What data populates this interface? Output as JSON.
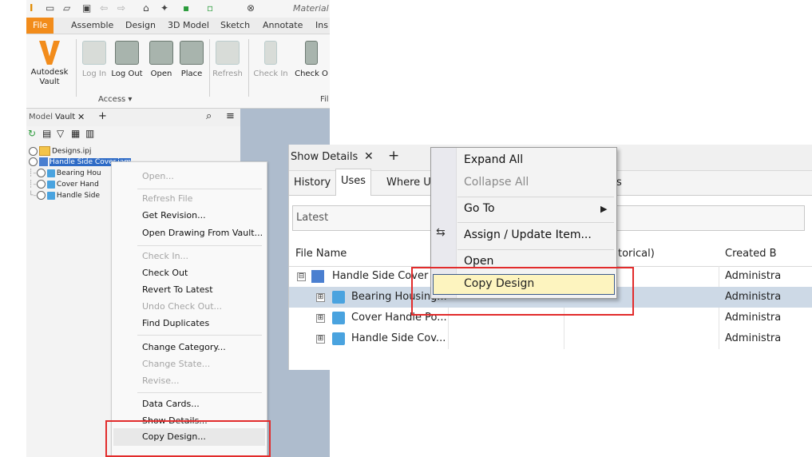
{
  "inventor": {
    "title": "Material",
    "tabs": [
      "File",
      "Assemble",
      "Design",
      "3D Model",
      "Sketch",
      "Annotate",
      "Ins"
    ],
    "ribbon": {
      "autodesk_vault": "Autodesk Vault",
      "buttons": [
        "Log In",
        "Log Out",
        "Open",
        "Place",
        "Refresh",
        "Check In",
        "Check O"
      ],
      "group_access": "Access ▾",
      "group_fi": "Fil"
    },
    "browser_tabs": {
      "model": "Model",
      "vault": "Vault",
      "close": "✕",
      "add": "+"
    },
    "tree": {
      "project": "Designs.ipj",
      "root": "Handle Side Cover.iam",
      "children": [
        "Bearing Hou",
        "Cover Hand",
        "Handle Side"
      ]
    },
    "context_menu": {
      "items": [
        {
          "label": "Open...",
          "disabled": true
        },
        {
          "label": "Refresh File",
          "disabled": true
        },
        {
          "label": "Get Revision...",
          "disabled": false
        },
        {
          "label": "Open Drawing From Vault...",
          "disabled": false
        },
        {
          "label": "Check In...",
          "disabled": true
        },
        {
          "label": "Check Out",
          "disabled": false
        },
        {
          "label": "Revert To Latest",
          "disabled": false
        },
        {
          "label": "Undo Check Out...",
          "disabled": true
        },
        {
          "label": "Find Duplicates",
          "disabled": false
        },
        {
          "label": "Change Category...",
          "disabled": false
        },
        {
          "label": "Change State...",
          "disabled": true
        },
        {
          "label": "Revise...",
          "disabled": true
        },
        {
          "label": "Data Cards...",
          "disabled": false
        },
        {
          "label": "Show Details...",
          "disabled": false
        },
        {
          "label": "Copy Design...",
          "disabled": false
        }
      ]
    }
  },
  "show_details": {
    "tab_title": "Show Details",
    "close": "✕",
    "add": "+",
    "subtabs": [
      "History",
      "Uses",
      "Where U",
      "s"
    ],
    "filter_value": "Latest",
    "columns": [
      "File Name",
      "torical)",
      "Created B"
    ],
    "rows": [
      {
        "name": "Handle Side Cover A",
        "created": "Administra",
        "expander": "⊟"
      },
      {
        "name": "Bearing Housing...",
        "created": "Administra",
        "expander": "⊞"
      },
      {
        "name": "Cover Handle Po...",
        "created": "Administra",
        "expander": "⊞"
      },
      {
        "name": "Handle Side Cov...",
        "created": "Administra",
        "expander": "⊞"
      }
    ],
    "context_menu": {
      "items": [
        {
          "label": "Expand All",
          "disabled": false
        },
        {
          "label": "Collapse All",
          "disabled": true
        },
        {
          "label": "Go To",
          "disabled": false,
          "submenu": true
        },
        {
          "label": "Assign / Update Item...",
          "disabled": false
        },
        {
          "label": "Open",
          "disabled": false
        },
        {
          "label": "Copy Design",
          "disabled": false
        }
      ]
    }
  },
  "colors": {
    "accent_file": "#f28c1b",
    "highlight": "#fdf4bf",
    "selection": "#2e6bc6",
    "callout": "#e22c2c"
  }
}
